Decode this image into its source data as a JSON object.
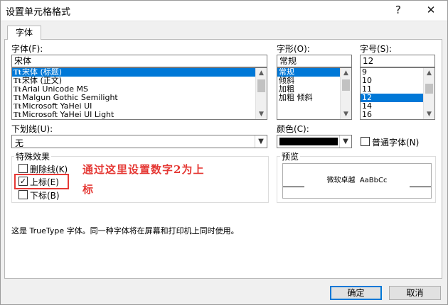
{
  "window": {
    "title": "设置单元格格式",
    "help_label": "?",
    "close_label": "✕"
  },
  "tabs": [
    {
      "label": "字体"
    }
  ],
  "font": {
    "label": "字体(F):",
    "value": "宋体",
    "items": [
      "宋体 (标题)",
      "宋体 (正文)",
      "Arial Unicode MS",
      "Malgun Gothic Semilight",
      "Microsoft YaHei UI",
      "Microsoft YaHei UI Light"
    ],
    "selected_index": 0,
    "item_icon": "Tt"
  },
  "style": {
    "label": "字形(O):",
    "value": "常规",
    "items": [
      "常规",
      "倾斜",
      "加粗",
      "加粗 倾斜"
    ],
    "selected_index": 0
  },
  "size": {
    "label": "字号(S):",
    "value": "12",
    "items": [
      "9",
      "10",
      "11",
      "12",
      "14",
      "16"
    ],
    "selected_index": 3
  },
  "underline": {
    "label": "下划线(U):",
    "value": "无"
  },
  "color": {
    "label": "颜色(C):",
    "swatch": "#000000"
  },
  "normal_font": {
    "label": "普通字体(N)",
    "checked": false
  },
  "effects": {
    "label": "特殊效果",
    "strikethrough": {
      "label": "删除线(K)",
      "checked": false
    },
    "superscript": {
      "label": "上标(E)",
      "checked": true,
      "check_mark": "✓"
    },
    "subscript": {
      "label": "下标(B)",
      "checked": false
    }
  },
  "preview": {
    "label": "预览",
    "sample": "微软卓越  AaBbCc"
  },
  "info_text": "这是 TrueType 字体。同一种字体将在屏幕和打印机上同时使用。",
  "annotation": {
    "line1": "通过这里设置数字2为上",
    "line2": "标"
  },
  "buttons": {
    "ok": "确定",
    "cancel": "取消"
  },
  "colors": {
    "accent": "#0078d7",
    "annotation": "#e53935"
  }
}
